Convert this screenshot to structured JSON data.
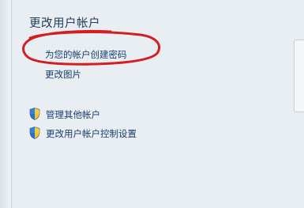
{
  "section": {
    "title": "更改用户帐户"
  },
  "links": {
    "create_password": "为您的帐户创建密码",
    "change_picture": "更改图片",
    "manage_accounts": "管理其他帐户",
    "uac_settings": "更改用户帐户控制设置"
  },
  "icons": {
    "manage_accounts": "uac-shield-icon",
    "uac_settings": "uac-shield-icon"
  },
  "colors": {
    "link": "#1a3d6b",
    "annotation": "#d21f22",
    "background": "#e9eef3"
  }
}
